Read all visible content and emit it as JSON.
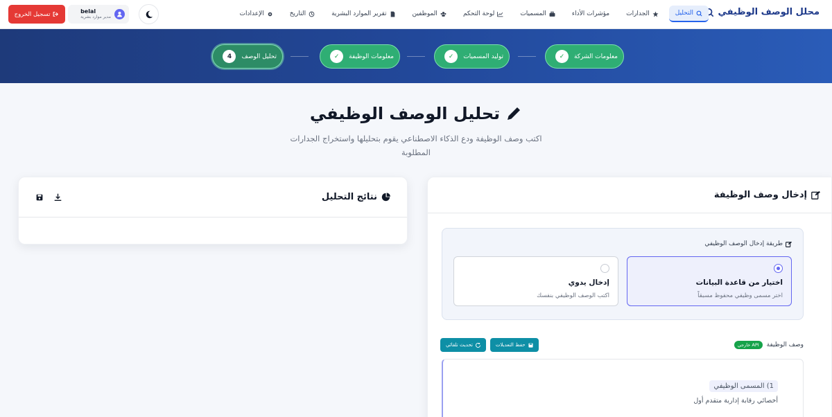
{
  "brand": {
    "title": "محلل الوصف الوظيفي"
  },
  "nav": [
    {
      "label": "التحليل",
      "icon": "search-icon",
      "active": true
    },
    {
      "label": "الجدارات",
      "icon": "star-icon"
    },
    {
      "label": "مؤشرات الأداء",
      "icon": ""
    },
    {
      "label": "المسميات",
      "icon": "briefcase-icon"
    },
    {
      "label": "لوحة التحكم",
      "icon": "chart-icon"
    },
    {
      "label": "الموظفين",
      "icon": "users-icon"
    },
    {
      "label": "تقرير الموارد البشرية",
      "icon": "file-icon"
    },
    {
      "label": "التاريخ",
      "icon": "history-icon"
    },
    {
      "label": "الإعدادات",
      "icon": "gear-icon"
    }
  ],
  "user": {
    "name": "belal",
    "role": "مدير موارد بشرية"
  },
  "logout": {
    "label": "تسجيل الخروج"
  },
  "steps": [
    {
      "label": "معلومات الشركة",
      "badge": "✓"
    },
    {
      "label": "توليد المسميات",
      "badge": "✓"
    },
    {
      "label": "معلومات الوظيفة",
      "badge": "✓"
    },
    {
      "label": "تحليل الوصف",
      "badge": "4"
    }
  ],
  "header": {
    "title": "تحليل الوصف الوظيفي",
    "subtitle": "اكتب وصف الوظيفة ودع الذكاء الاصطناعي يقوم بتحليلها واستخراج الجدارات المطلوبة"
  },
  "results": {
    "title": "نتائج التحليل"
  },
  "input": {
    "title": "إدخال وصف الوظيفة",
    "method_label": "طريقة إدخال الوصف الوظيفي",
    "options": [
      {
        "title": "اختيار من قاعدة البيانات",
        "desc": "اختر مسمى وظيفي محفوظ مسبقاً"
      },
      {
        "title": "إدخال يدوي",
        "desc": "اكتب الوصف الوظيفي بنفسك"
      }
    ],
    "jd_label": "وصف الوظيفة",
    "api_badge": "API خارجي",
    "save_label": "حفظ التعديلات",
    "refresh_label": "تحديث تلقائي",
    "section_title": "1) المسمى الوظيفي",
    "section_text": "أخصائي رقابة إدارية متقدم أول"
  },
  "colors": {
    "accent": "#2563eb",
    "success": "#2fae74",
    "danger": "#e53935",
    "teal": "#0e8fa6"
  }
}
